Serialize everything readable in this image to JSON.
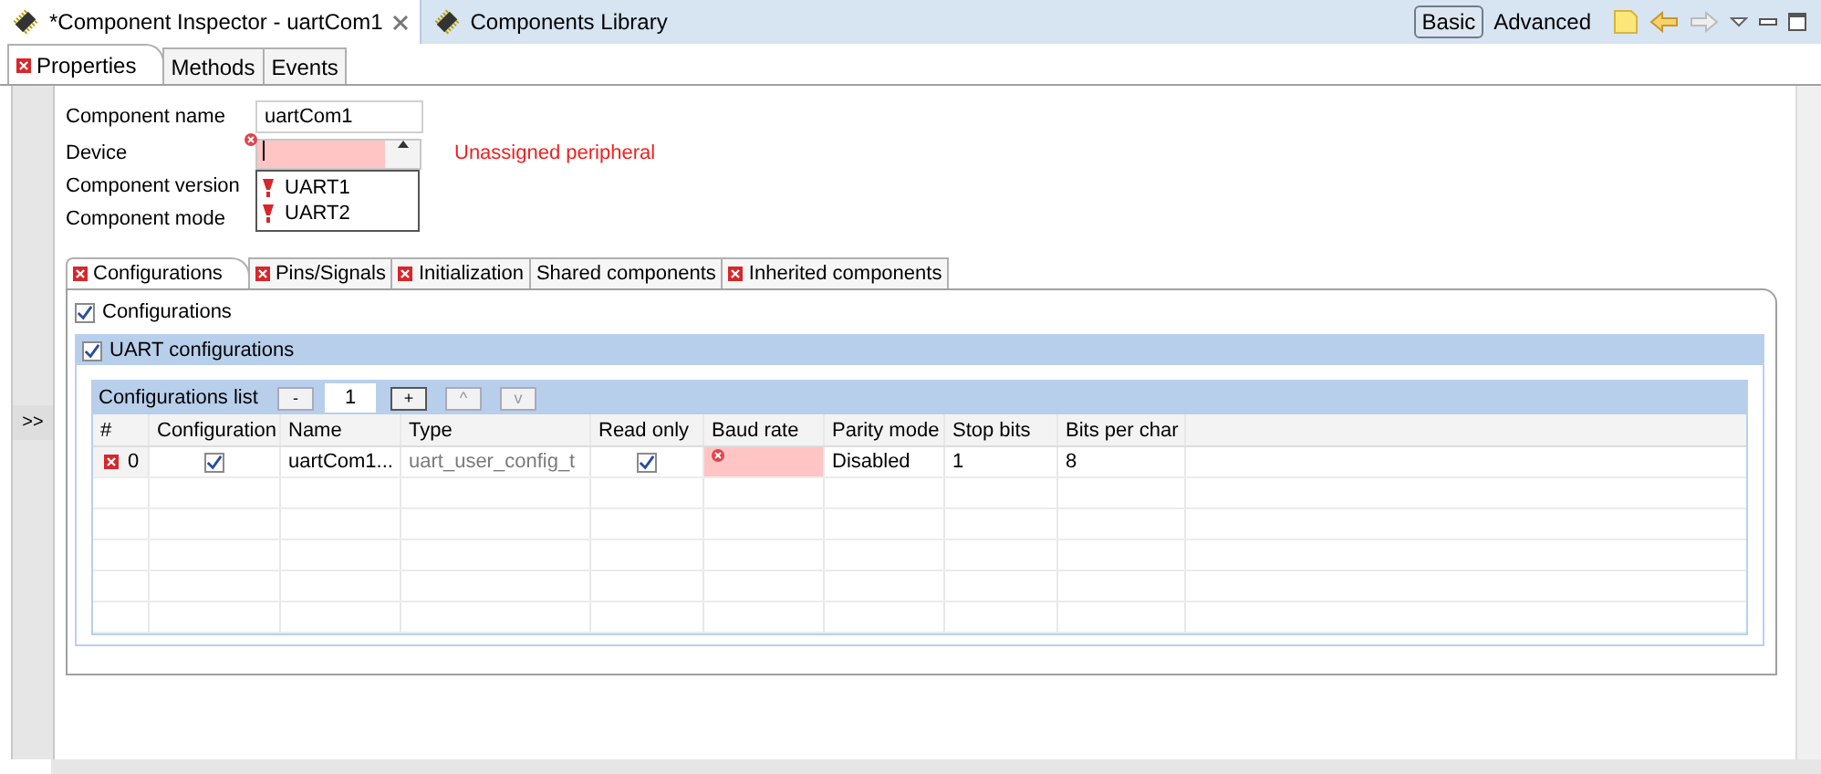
{
  "editor_tabs": [
    {
      "label": "*Component Inspector - uartCom1",
      "selected": true,
      "closable": true
    },
    {
      "label": "Components Library",
      "selected": false,
      "closable": false
    }
  ],
  "view_modes": [
    {
      "label": "Basic",
      "selected": true
    },
    {
      "label": "Advanced",
      "selected": false
    }
  ],
  "property_tabs": [
    {
      "label": "Properties",
      "selected": true,
      "error": true
    },
    {
      "label": "Methods",
      "selected": false,
      "error": false
    },
    {
      "label": "Events",
      "selected": false,
      "error": false
    }
  ],
  "collapse_button": ">>",
  "form": {
    "fields": [
      {
        "label": "Component name",
        "kind": "text",
        "value": "uartCom1"
      },
      {
        "label": "Device",
        "kind": "combo",
        "error": true,
        "message": "Unassigned peripheral"
      },
      {
        "label": "Component version",
        "kind": "plain"
      },
      {
        "label": "Component mode",
        "kind": "plain"
      }
    ],
    "dropdown_options": [
      "UART1",
      "UART2"
    ]
  },
  "config_tabs": [
    {
      "label": "Configurations",
      "selected": true,
      "error": true
    },
    {
      "label": "Pins/Signals",
      "selected": false,
      "error": true
    },
    {
      "label": "Initialization",
      "selected": false,
      "error": true
    },
    {
      "label": "Shared components",
      "selected": false,
      "error": false
    },
    {
      "label": "Inherited components",
      "selected": false,
      "error": true
    }
  ],
  "configurations": {
    "label": "Configurations",
    "checked": true
  },
  "group": {
    "label": "UART configurations",
    "checked": true
  },
  "list": {
    "title": "Configurations list",
    "buttons": [
      "-",
      "+",
      "^",
      "v"
    ],
    "count": "1",
    "columns": [
      "#",
      "Configuration",
      "Name",
      "Type",
      "Read only",
      "Baud rate",
      "Parity mode",
      "Stop bits",
      "Bits per char"
    ],
    "rows": [
      {
        "index": "0",
        "error": true,
        "configuration": true,
        "name": "uartCom1...",
        "type": "uart_user_config_t",
        "read_only": true,
        "baud_error": true,
        "parity": "Disabled",
        "stop": "1",
        "bits": "8"
      }
    ]
  }
}
